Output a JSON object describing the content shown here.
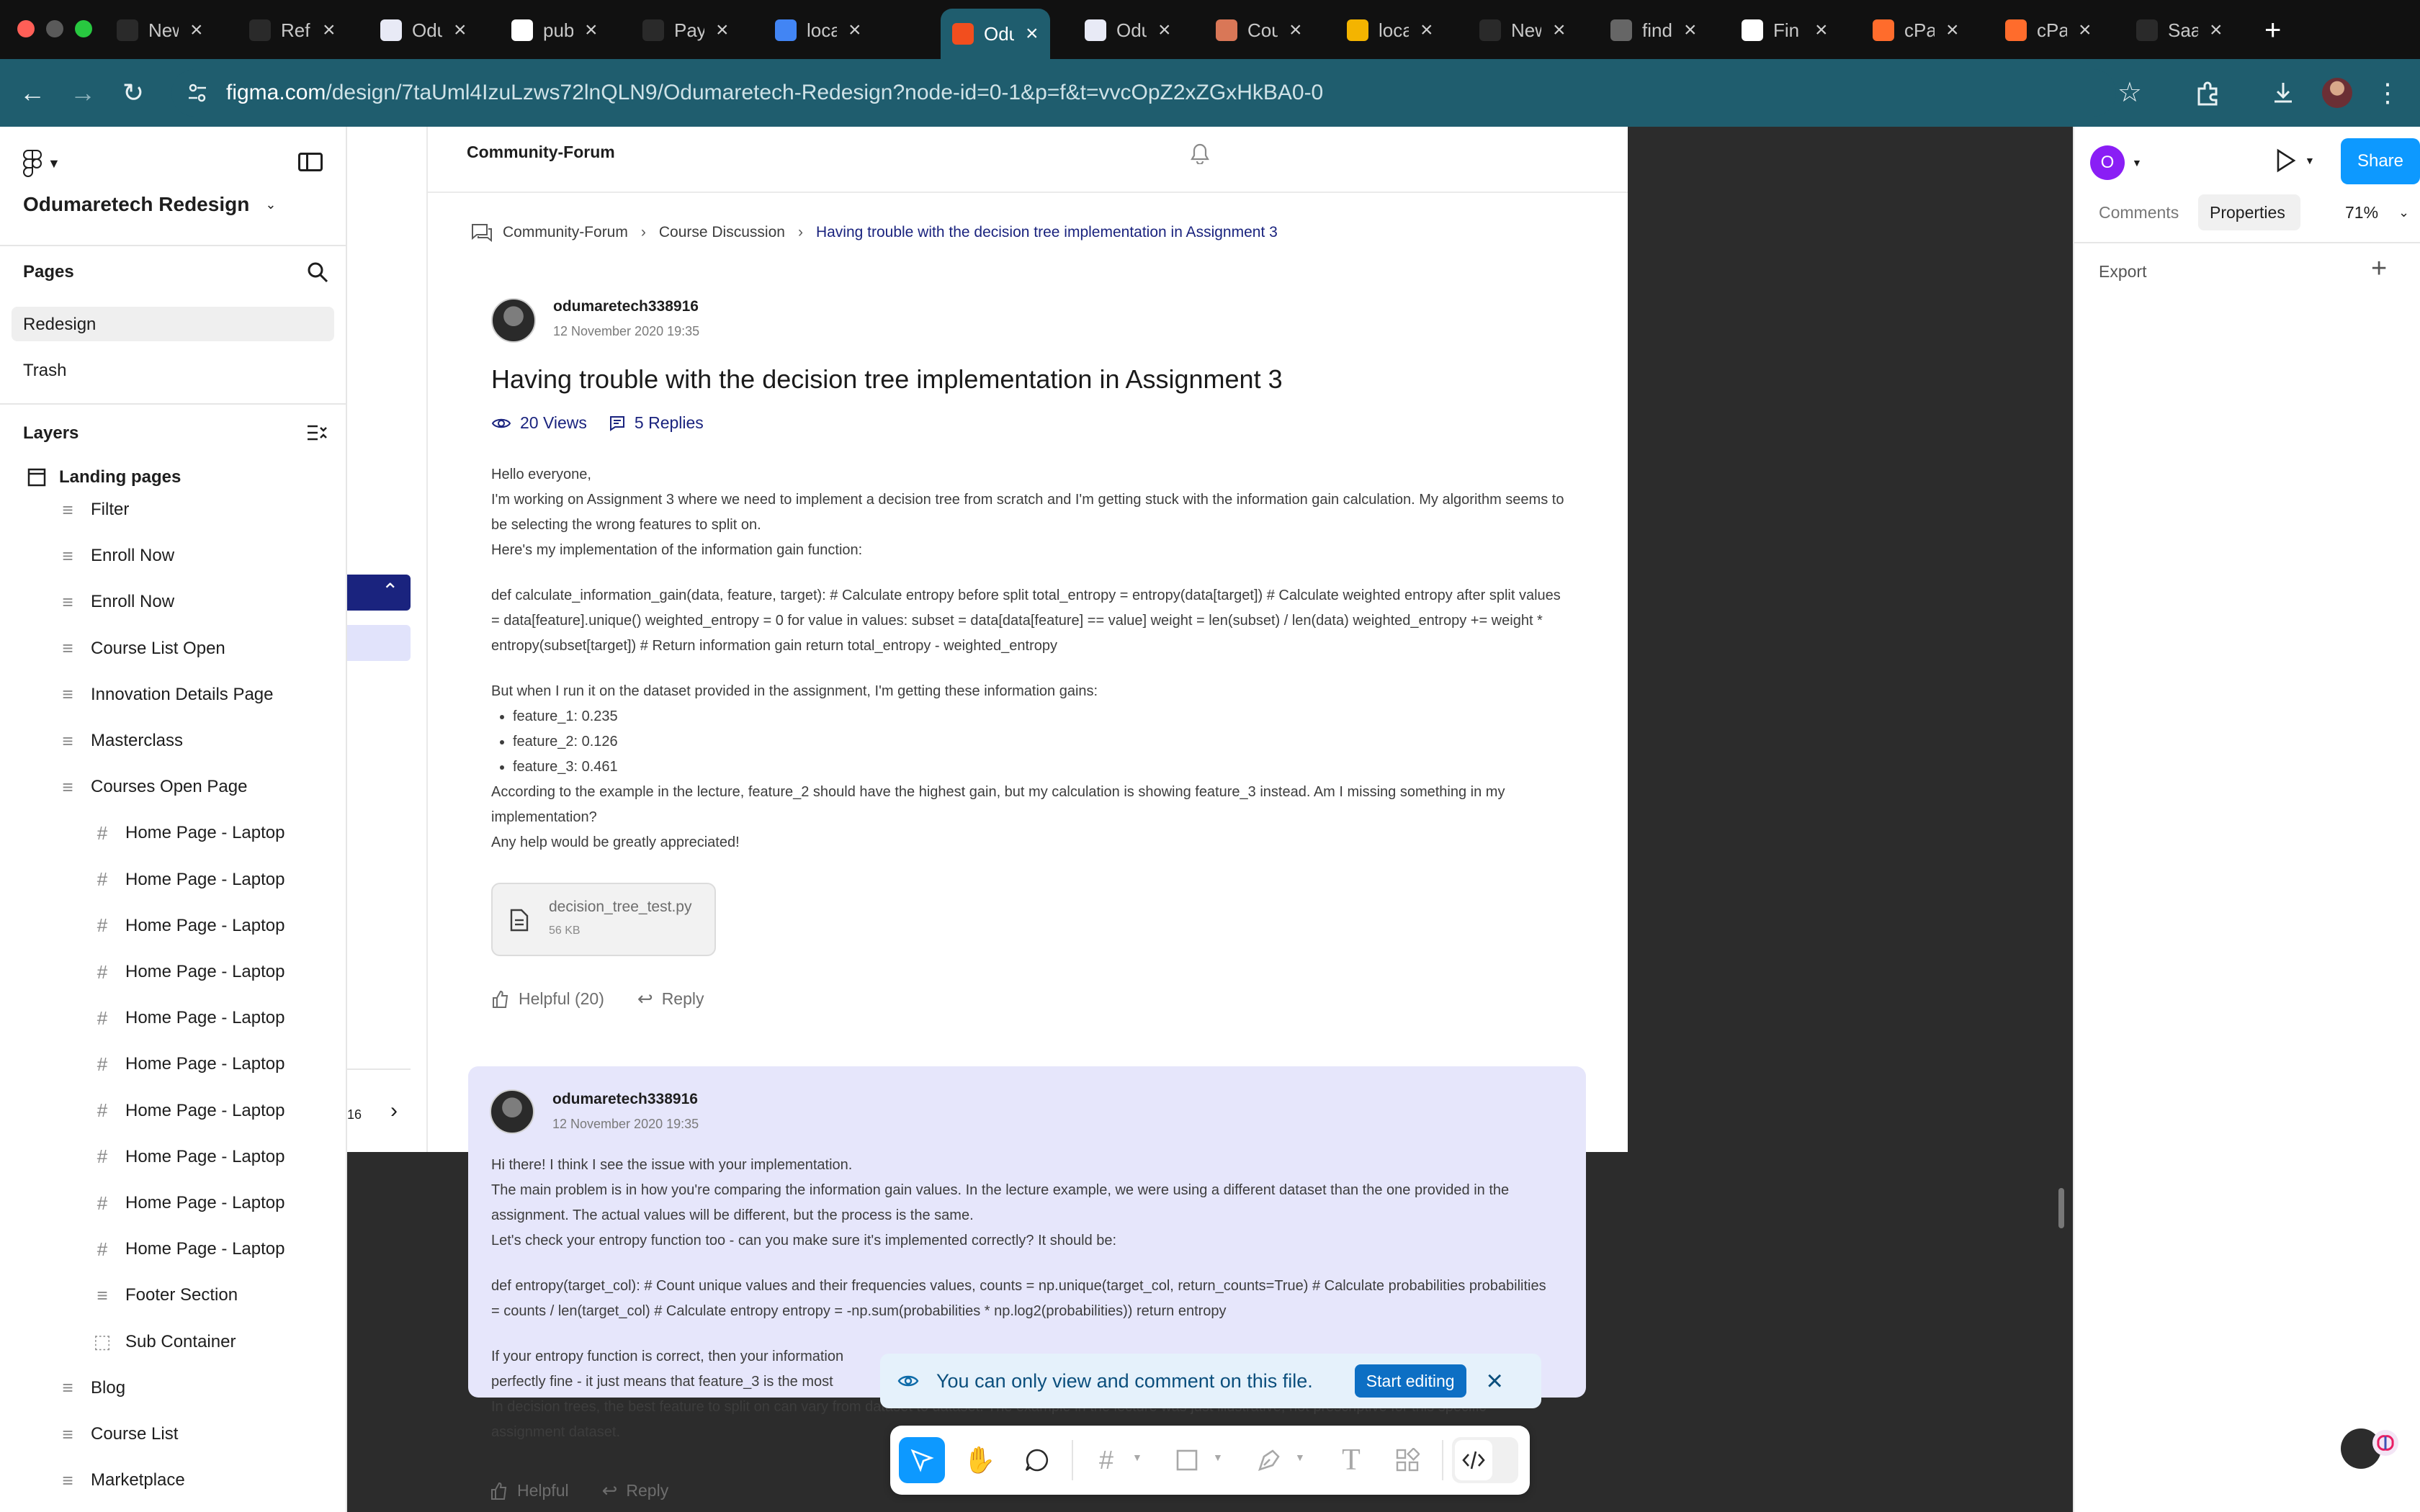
{
  "browser": {
    "tabs": [
      {
        "label": "New",
        "favicon": "chatgpt-icon"
      },
      {
        "label": "Ref",
        "favicon": "chatgpt-icon"
      },
      {
        "label": "Odu",
        "favicon": "odumaretech-icon"
      },
      {
        "label": "pub",
        "favicon": "google-icon"
      },
      {
        "label": "Pay",
        "favicon": "chatgpt-icon"
      },
      {
        "label": "loca",
        "favicon": "docs-icon"
      },
      {
        "label": "Odu",
        "favicon": "figma-icon",
        "active": true
      },
      {
        "label": "Odu",
        "favicon": "odumaretech-icon"
      },
      {
        "label": "Cou",
        "favicon": "claude-icon"
      },
      {
        "label": "loca",
        "favicon": "drive-icon"
      },
      {
        "label": "New",
        "favicon": "chatgpt-icon"
      },
      {
        "label": "find",
        "favicon": "globe-icon"
      },
      {
        "label": "Fin",
        "favicon": "fin-icon"
      },
      {
        "label": "cPa",
        "favicon": "cpanel-icon"
      },
      {
        "label": "cPa",
        "favicon": "cpanel-icon"
      },
      {
        "label": "Saa",
        "favicon": "chatgpt-icon"
      }
    ],
    "new_tab": "+",
    "url_host": "figma.com",
    "url_path": "/design/7taUml4IzuLzws72lnQLN9/Odumaretech-Redesign?node-id=0-1&p=f&t=vvcOpZ2xZGxHkBA0-0"
  },
  "left_panel": {
    "project_title": "Odumaretech Redesign",
    "pages_label": "Pages",
    "pages": [
      "Redesign",
      "Trash"
    ],
    "layers_label": "Layers",
    "layers_root": "Landing pages",
    "layers": [
      {
        "label": "Filter",
        "indent": 1,
        "icon": "section-icon"
      },
      {
        "label": "Enroll Now",
        "indent": 1,
        "icon": "section-icon"
      },
      {
        "label": "Enroll Now",
        "indent": 1,
        "icon": "section-icon"
      },
      {
        "label": "Course List Open",
        "indent": 1,
        "icon": "section-icon"
      },
      {
        "label": "Innovation Details Page",
        "indent": 1,
        "icon": "section-icon"
      },
      {
        "label": "Masterclass",
        "indent": 1,
        "icon": "section-icon"
      },
      {
        "label": "Courses Open Page",
        "indent": 1,
        "icon": "section-icon"
      },
      {
        "label": "Home Page - Laptop",
        "indent": 2,
        "icon": "frame-icon"
      },
      {
        "label": "Home Page - Laptop",
        "indent": 2,
        "icon": "frame-icon"
      },
      {
        "label": "Home Page - Laptop",
        "indent": 2,
        "icon": "frame-icon"
      },
      {
        "label": "Home Page - Laptop",
        "indent": 2,
        "icon": "frame-icon"
      },
      {
        "label": "Home Page - Laptop",
        "indent": 2,
        "icon": "frame-icon"
      },
      {
        "label": "Home Page - Laptop",
        "indent": 2,
        "icon": "frame-icon"
      },
      {
        "label": "Home Page - Laptop",
        "indent": 2,
        "icon": "frame-icon"
      },
      {
        "label": "Home Page - Laptop",
        "indent": 2,
        "icon": "frame-icon"
      },
      {
        "label": "Home Page - Laptop",
        "indent": 2,
        "icon": "frame-icon"
      },
      {
        "label": "Home Page - Laptop",
        "indent": 2,
        "icon": "frame-icon"
      },
      {
        "label": "Footer Section",
        "indent": 2,
        "icon": "section-icon"
      },
      {
        "label": "Sub Container",
        "indent": 2,
        "icon": "container-icon"
      },
      {
        "label": "Blog",
        "indent": 1,
        "icon": "section-icon"
      },
      {
        "label": "Course List",
        "indent": 1,
        "icon": "section-icon"
      },
      {
        "label": "Marketplace",
        "indent": 1,
        "icon": "section-icon"
      }
    ]
  },
  "right_panel": {
    "avatar_letter": "O",
    "share_label": "Share",
    "tabs": [
      "Comments",
      "Properties"
    ],
    "active_tab": "Properties",
    "zoom": "71%",
    "export_label": "Export"
  },
  "frame": {
    "page_title": "Community-Forum",
    "side_page_number": "16",
    "breadcrumb": [
      "Community-Forum",
      "Course Discussion",
      "Having trouble with the decision tree implementation in Assignment 3"
    ],
    "post": {
      "author": "odumaretech338916",
      "date": "12 November 2020 19:35",
      "title": "Having trouble with the decision tree implementation in Assignment 3",
      "views": "20 Views",
      "replies": "5 Replies",
      "body": [
        "Hello everyone,",
        "I'm working on Assignment 3 where we need to implement a decision tree from scratch and I'm getting stuck with the information gain calculation. My algorithm seems to be selecting the wrong features to split on.",
        "Here's my implementation of the information gain function:"
      ],
      "code": "def calculate_information_gain(data, feature, target): # Calculate entropy before split total_entropy = entropy(data[target]) # Calculate weighted entropy after split values = data[feature].unique() weighted_entropy = 0 for value in values: subset = data[data[feature] == value] weight = len(subset) / len(data) weighted_entropy += weight * entropy(subset[target]) # Return information gain return total_entropy - weighted_entropy",
      "gains_intro": "But when I run it on the dataset provided in the assignment, I'm getting these information gains:",
      "gains": [
        "feature_1: 0.235",
        "feature_2: 0.126",
        "feature_3: 0.461"
      ],
      "closing": [
        "According to the example in the lecture, feature_2 should have the highest gain, but my calculation is showing feature_3 instead. Am I missing something in my implementation?",
        "Any help would be greatly appreciated!"
      ],
      "attachment_name": "decision_tree_test.py",
      "attachment_size": "56 KB",
      "helpful": "Helpful (20)",
      "reply": "Reply"
    },
    "answer": {
      "author": "odumaretech338916",
      "date": "12 November 2020 19:35",
      "body": [
        "Hi there! I think I see the issue with your implementation.",
        "The main problem is in how you're comparing the information gain values. In the lecture example, we were using a different dataset than the one provided in the assignment. The actual values will be different, but the process is the same.",
        "Let's check your entropy function too - can you make sure it's implemented correctly? It should be:"
      ],
      "code": "def entropy(target_col): # Count unique values and their frequencies values, counts = np.unique(target_col, return_counts=True) # Calculate probabilities probabilities = counts / len(target_col) # Calculate entropy entropy = -np.sum(probabilities * np.log2(probabilities)) return entropy",
      "tail_1a": "If your entropy function is correct, then your information",
      "tail_1b": "perfectly fine - it just means that feature_3 is the most",
      "tail_2": "In decision trees, the best feature to split on can vary from dataset to dataset. The example in the lecture was just illustrative, not prescriptive for this specific assignment dataset.",
      "helpful": "Helpful",
      "reply": "Reply"
    }
  },
  "banner": {
    "message": "You can only view and comment on this file.",
    "action": "Start editing"
  },
  "colors": {
    "accent": "#0d99ff",
    "breadcrumb_active": "#1a237e",
    "reply_card_bg": "#e6e6fb",
    "selection_navy": "#1a237e"
  }
}
